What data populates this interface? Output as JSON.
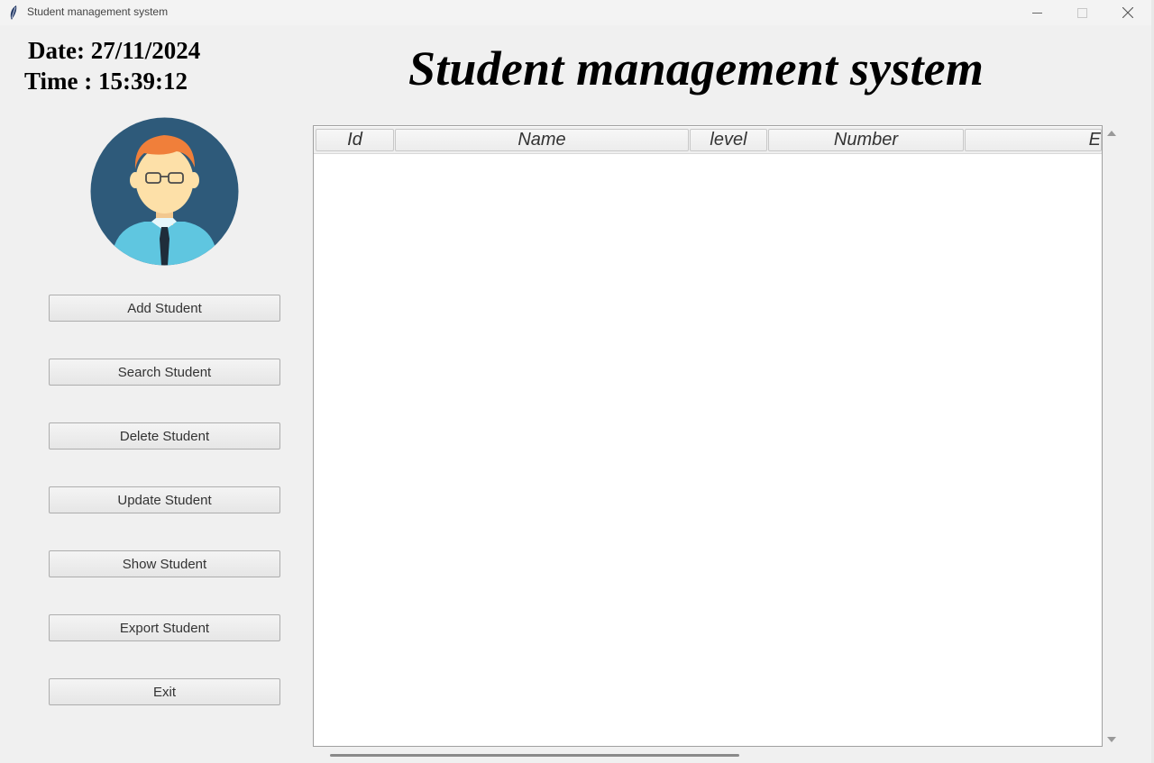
{
  "window": {
    "title": "Student management system",
    "icon": "feather-icon",
    "controls": [
      "minimize-icon",
      "maximize-icon",
      "close-icon"
    ]
  },
  "header": {
    "date": "Date: 27/11/2024",
    "time": "Time : 15:39:12",
    "title": "Student management system"
  },
  "avatar": {
    "icon": "student-avatar-icon"
  },
  "menu": {
    "add": "Add Student",
    "search": "Search Student",
    "delete": "Delete Student",
    "update": "Update Student",
    "show": "Show Student",
    "export": "Export Student",
    "exit": "Exit"
  },
  "table": {
    "columns": [
      "Id",
      "Name",
      "level",
      "Number",
      "E"
    ],
    "rows": []
  },
  "colors": {
    "avatar_bg": "#2e5a7a",
    "hair": "#f07f3a",
    "skin": "#fde0a8",
    "shirt": "#5fc6e0",
    "tie": "#1f2d3a"
  }
}
